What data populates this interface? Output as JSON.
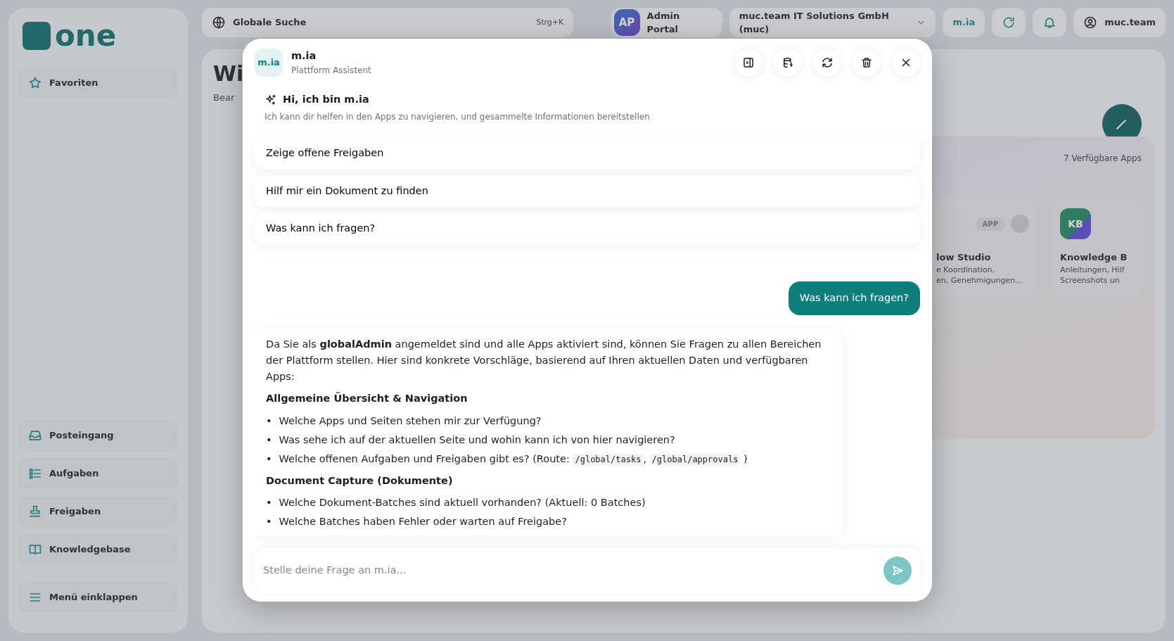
{
  "background": {
    "logo": {
      "text": "one"
    },
    "sidebar": {
      "top_items": [
        {
          "label": "Favoriten"
        }
      ],
      "bottom_items": [
        {
          "label": "Posteingang"
        },
        {
          "label": "Aufgaben"
        },
        {
          "label": "Freigaben"
        },
        {
          "label": "Knowledgebase"
        }
      ],
      "collapse": "Menü einklappen"
    },
    "topbar": {
      "search": {
        "placeholder": "Globale Suche",
        "shortcut": "Strg+K"
      },
      "portal": {
        "avatar": "AP",
        "label": "Admin Portal"
      },
      "org": "muc.team IT Solutions GmbH (muc)",
      "assistant_button": "m.ia",
      "user": "muc.team"
    },
    "page": {
      "title": "Wi",
      "subtitle": "Bear"
    },
    "apps": {
      "count": "7 Verfügbare Apps",
      "cards": [
        {
          "badge": "APP",
          "title": "low Studio",
          "lines": [
            "e Koordination,",
            "en, Genehmigungen..."
          ]
        },
        {
          "icon": "KB",
          "title": "Knowledge B",
          "lines": [
            "Anleitungen, Hilf",
            "Screenshots un"
          ]
        }
      ]
    }
  },
  "chat": {
    "avatar": "m.ia",
    "title": "m.ia",
    "subtitle": "Plattform Assistent",
    "greeting": {
      "title": "Hi, ich bin m.ia",
      "text": "Ich kann dir helfen in den Apps zu navigieren, und gesammelte Informationen bereitstellen"
    },
    "suggestions": [
      "Zeige offene Freigaben",
      "Hilf mir ein Dokument zu finden",
      "Was kann ich fragen?"
    ],
    "messages": [
      {
        "kind": "user",
        "text": "Was kann ich fragen?"
      },
      {
        "kind": "assistant",
        "blocks": [
          {
            "kind": "paragraph",
            "text": "Da Sie als **globalAdmin** angemeldet sind und alle Apps aktiviert sind, können Sie Fragen zu allen Bereichen der Plattform stellen. Hier sind konkrete Vorschläge, basierend auf Ihren aktuellen Daten und verfügbaren Apps:"
          },
          {
            "kind": "heading",
            "text": "Allgemeine Übersicht & Navigation"
          },
          {
            "kind": "list",
            "marker": "•",
            "items": [
              [
                {
                  "text": "Welche Apps und Seiten stehen mir zur Verfügung?"
                }
              ],
              [
                {
                  "text": "Was sehe ich auf der aktuellen Seite und wohin kann ich von hier navigieren?"
                }
              ],
              [
                {
                  "text": "Welche offenen Aufgaben und Freigaben gibt es? (Route: "
                },
                {
                  "code": "/global/tasks"
                },
                {
                  "text": ", "
                },
                {
                  "code": "/global/approvals"
                },
                {
                  "text": " )"
                }
              ]
            ]
          },
          {
            "kind": "heading",
            "text": "Document Capture (Dokumente)"
          },
          {
            "kind": "list",
            "marker": "•",
            "items": [
              [
                {
                  "text": "Welche Dokument-Batches sind aktuell vorhanden? (Aktuell: 0 Batches)"
                }
              ],
              [
                {
                  "text": "Welche Batches haben Fehler oder warten auf Freigabe?"
                }
              ]
            ]
          }
        ]
      }
    ],
    "input": {
      "placeholder": "Stelle deine Frage an m.ia..."
    }
  }
}
